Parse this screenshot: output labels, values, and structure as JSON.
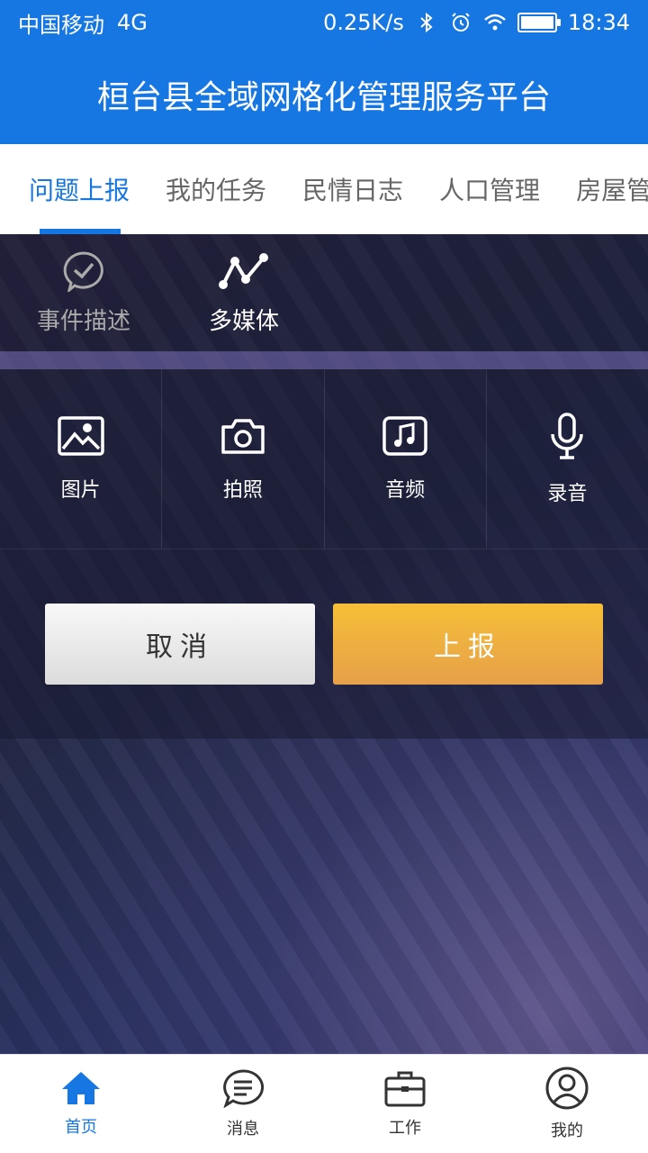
{
  "status_bar": {
    "carrier": "中国移动",
    "network": "4G",
    "speed": "0.25K/s",
    "time": "18:34",
    "icons": [
      "bluetooth-icon",
      "alarm-icon",
      "wifi-icon",
      "battery-icon"
    ]
  },
  "header": {
    "title": "桓台县全域网格化管理服务平台"
  },
  "tabs": [
    {
      "label": "问题上报",
      "active": true
    },
    {
      "label": "我的任务"
    },
    {
      "label": "民情日志"
    },
    {
      "label": "人口管理"
    },
    {
      "label": "房屋管"
    }
  ],
  "subtabs": [
    {
      "label": "事件描述",
      "icon": "check-circle-icon"
    },
    {
      "label": "多媒体",
      "icon": "media-graph-icon",
      "active": true
    }
  ],
  "media": [
    {
      "label": "图片",
      "icon": "image-icon"
    },
    {
      "label": "拍照",
      "icon": "camera-icon"
    },
    {
      "label": "音频",
      "icon": "music-icon"
    },
    {
      "label": "录音",
      "icon": "microphone-icon"
    }
  ],
  "actions": {
    "cancel": "取消",
    "submit": "上报"
  },
  "bottom_nav": [
    {
      "label": "首页",
      "icon": "home-icon",
      "active": true
    },
    {
      "label": "消息",
      "icon": "message-icon"
    },
    {
      "label": "工作",
      "icon": "briefcase-icon"
    },
    {
      "label": "我的",
      "icon": "user-icon"
    }
  ],
  "colors": {
    "primary": "#1677e3",
    "submit": "#f0b13e"
  }
}
